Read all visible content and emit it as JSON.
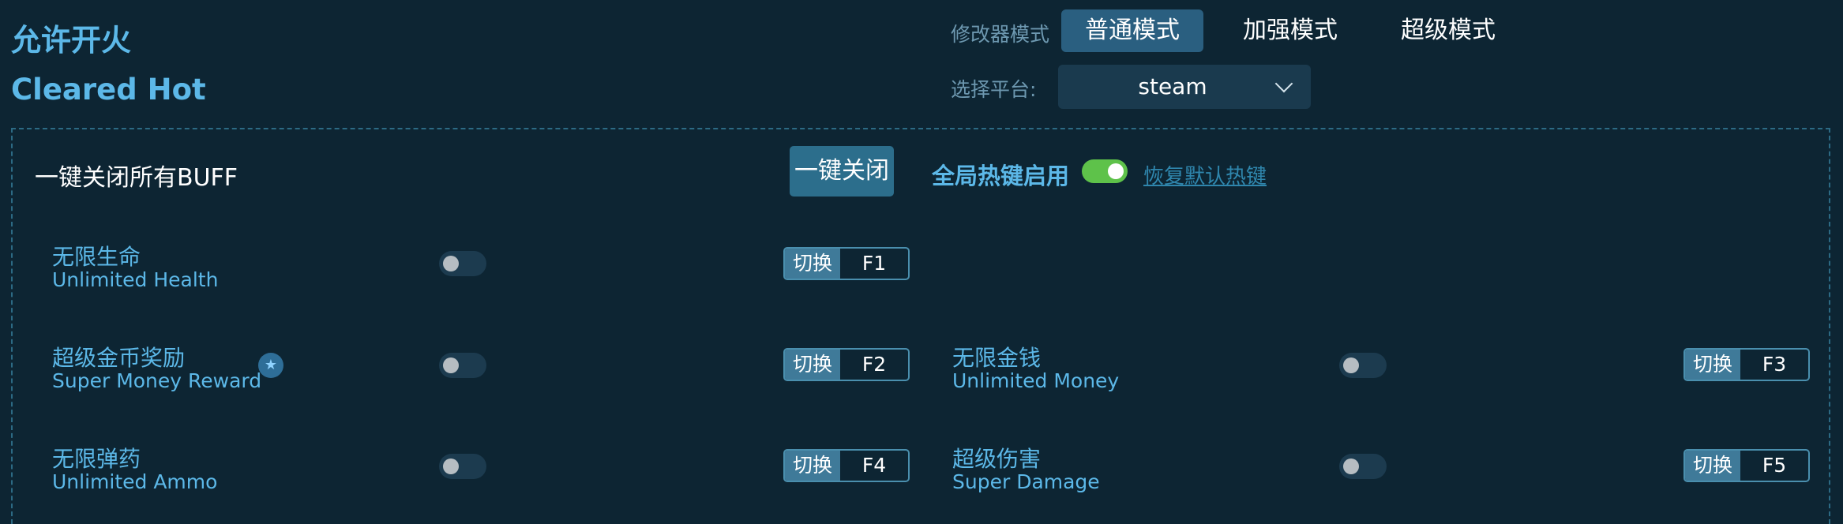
{
  "header": {
    "title_cn": "允许开火",
    "title_en": "Cleared Hot",
    "mode_label": "修改器模式",
    "modes": [
      {
        "label": "普通模式",
        "active": true
      },
      {
        "label": "加强模式",
        "active": false
      },
      {
        "label": "超级模式",
        "active": false
      }
    ],
    "platform_label": "选择平台:",
    "platform_value": "steam"
  },
  "controls": {
    "buff_label": "一键关闭所有BUFF",
    "close_all_label": "一键关闭",
    "hotkey_label": "全局热键启用",
    "hotkey_enabled": true,
    "restore_label": "恢复默认热键"
  },
  "colors": {
    "background": "#0d2533",
    "accent": "#5cb8e8",
    "toggle_on": "#5ec24a"
  },
  "features": [
    {
      "cn": "无限生命",
      "en": "Unlimited Health",
      "toggle_tag": "切换",
      "key": "F1",
      "enabled": false,
      "starred": false
    },
    {
      "cn": "超级金币奖励",
      "en": "Super Money Reward",
      "toggle_tag": "切换",
      "key": "F2",
      "enabled": false,
      "starred": true,
      "star_icon": "star-icon"
    },
    {
      "cn": "无限金钱",
      "en": "Unlimited Money",
      "toggle_tag": "切换",
      "key": "F3",
      "enabled": false,
      "starred": false
    },
    {
      "cn": "无限弹药",
      "en": "Unlimited Ammo",
      "toggle_tag": "切换",
      "key": "F4",
      "enabled": false,
      "starred": false
    },
    {
      "cn": "超级伤害",
      "en": "Super Damage",
      "toggle_tag": "切换",
      "key": "F5",
      "enabled": false,
      "starred": false
    }
  ]
}
